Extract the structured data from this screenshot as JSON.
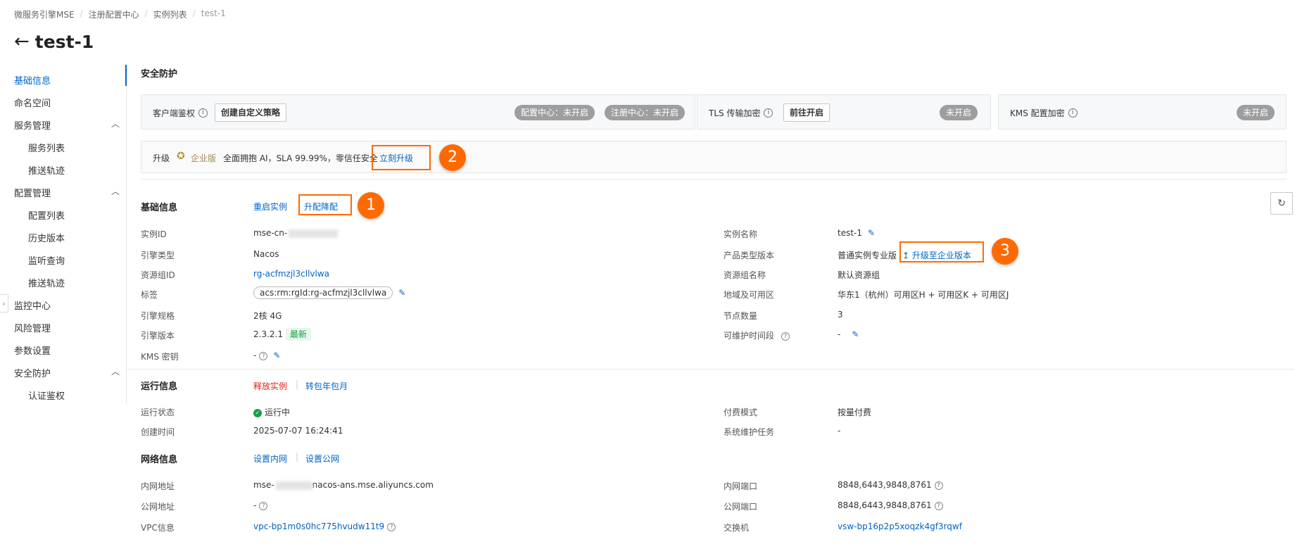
{
  "breadcrumb": [
    "微服务引擎MSE",
    "注册配置中心",
    "实例列表",
    "test-1"
  ],
  "page_title": "test-1",
  "sidebar": {
    "basic_info": "基础信息",
    "namespace": "命名空间",
    "service_mgmt": "服务管理",
    "service_list": "服务列表",
    "push_trace_1": "推送轨迹",
    "config_mgmt": "配置管理",
    "config_list": "配置列表",
    "history": "历史版本",
    "listen_query": "监听查询",
    "push_trace_2": "推送轨迹",
    "monitor": "监控中心",
    "risk": "风险管理",
    "params": "参数设置",
    "security": "安全防护",
    "auth": "认证鉴权"
  },
  "security": {
    "title": "安全防护",
    "client_auth_label": "客户端鉴权",
    "create_policy_button": "创建自定义策略",
    "config_center_status": "配置中心：未开启",
    "registry_center_status": "注册中心：未开启",
    "tls_label": "TLS 传输加密",
    "tls_button": "前往开启",
    "tls_status": "未开启",
    "kms_label": "KMS 配置加密",
    "kms_status": "未开启"
  },
  "upgrade_bar": {
    "prefix": "升级",
    "edition": "企业版",
    "text": "全面拥抱 AI，SLA 99.99%，零信任安全",
    "link": "立刻升级"
  },
  "callouts": {
    "one": "1",
    "two": "2",
    "three": "3"
  },
  "basic": {
    "title": "基础信息",
    "restart": "重启实例",
    "upgrade_downgrade": "升配降配",
    "instance_id_label": "实例ID",
    "instance_id_value": "mse-cn-",
    "engine_type_label": "引擎类型",
    "engine_type_value": "Nacos",
    "rg_id_label": "资源组ID",
    "rg_id_value": "rg-acfmzjl3cllvlwa",
    "tag_label": "标签",
    "tag_value": "acs:rm:rgId:rg-acfmzjl3cllvlwa",
    "spec_label": "引擎规格",
    "spec_value": "2核 4G",
    "version_label": "引擎版本",
    "version_value": "2.3.2.1",
    "version_tag": "最新",
    "kms_key_label": "KMS 密钥",
    "kms_key_value": "-",
    "name_label": "实例名称",
    "name_value": "test-1",
    "product_label": "产品类型版本",
    "product_value": "普通实例专业版",
    "upgrade_enterprise": "升级至企业版本",
    "rg_name_label": "资源组名称",
    "rg_name_value": "默认资源组",
    "region_label": "地域及可用区",
    "region_value": "华东1（杭州）可用区H + 可用区K + 可用区J",
    "nodes_label": "节点数量",
    "nodes_value": "3",
    "maint_label": "可维护时间段",
    "maint_value": "-"
  },
  "runtime": {
    "title": "运行信息",
    "release": "释放实例",
    "to_monthly": "转包年包月",
    "status_label": "运行状态",
    "status_value": "运行中",
    "created_label": "创建时间",
    "created_value": "2025-07-07 16:24:41",
    "billing_label": "付费模式",
    "billing_value": "按量付费",
    "maint_task_label": "系统维护任务",
    "maint_task_value": "-"
  },
  "network": {
    "title": "网络信息",
    "set_private": "设置内网",
    "set_public": "设置公网",
    "private_addr_label": "内网地址",
    "private_addr_prefix": "mse-",
    "private_addr_suffix": "nacos-ans.mse.aliyuncs.com",
    "public_addr_label": "公网地址",
    "public_addr_value": "-",
    "vpc_label": "VPC信息",
    "vpc_value": "vpc-bp1m0s0hc775hvudw11t9",
    "private_port_label": "内网端口",
    "private_port_value": "8848,6443,9848,8761",
    "public_port_label": "公网端口",
    "public_port_value": "8848,6443,9848,8761",
    "vswitch_label": "交换机",
    "vswitch_value": "vsw-bp16p2p5xoqzk4gf3rqwf"
  },
  "colors": {
    "accent": "#0064c8",
    "callout": "#ff6a00",
    "danger": "#e1251b",
    "success": "#1a9e4a"
  }
}
